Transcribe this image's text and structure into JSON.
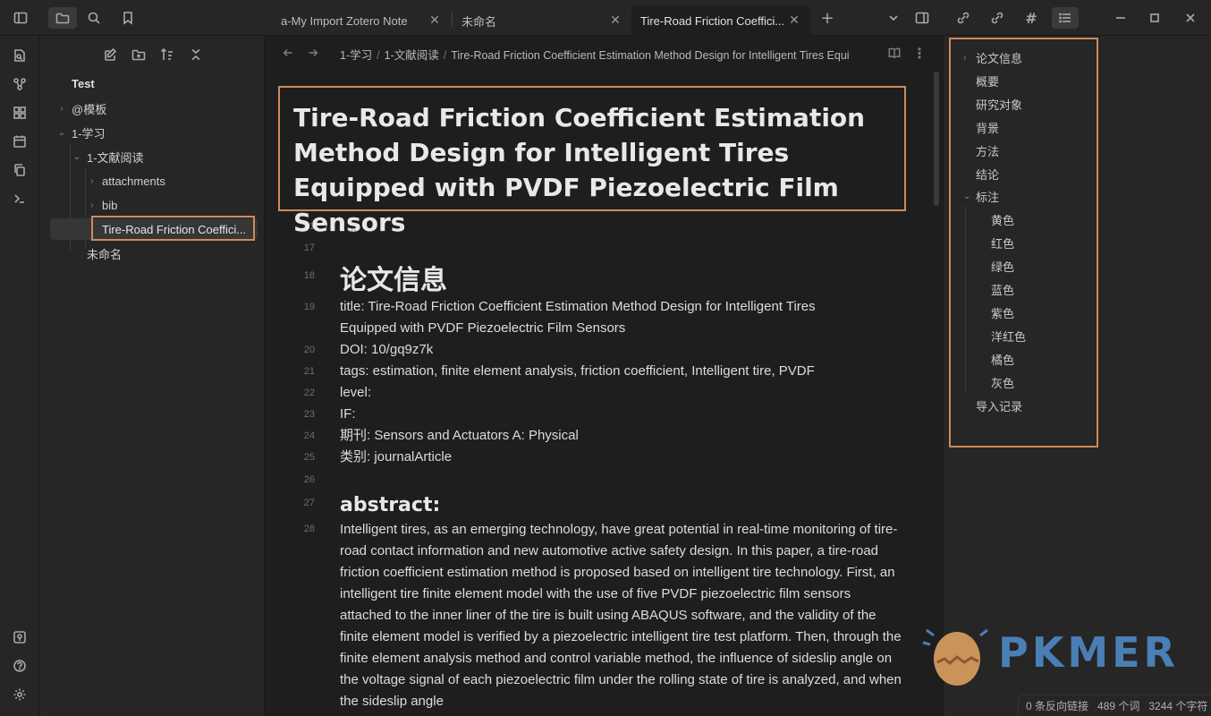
{
  "tabs": [
    {
      "label": "a-My Import Zotero Note",
      "active": false
    },
    {
      "label": "未命名",
      "active": false
    },
    {
      "label": "Tire-Road Friction Coeffici...",
      "active": true
    }
  ],
  "explorer": {
    "vault": "Test",
    "items": [
      {
        "label": "@模板",
        "expanded": false
      },
      {
        "label": "1-学习",
        "expanded": true
      },
      {
        "label": "1-文献阅读",
        "expanded": true
      },
      {
        "label": "attachments",
        "expanded": false
      },
      {
        "label": "bib",
        "expanded": false
      },
      {
        "label": "Tire-Road Friction Coeffici...",
        "selected": true
      },
      {
        "label": "未命名"
      }
    ]
  },
  "breadcrumb": [
    "1-学习",
    "1-文献阅读",
    "Tire-Road Friction Coefficient Estimation Method Design for Intelligent Tires Equi"
  ],
  "editor": {
    "title": "Tire-Road Friction Coefficient Estimation Method Design for Intelligent Tires Equipped with PVDF Piezoelectric Film Sensors",
    "folded_line": "1",
    "folded_text": "...",
    "lines": [
      {
        "n": "17",
        "text": ""
      },
      {
        "n": "18",
        "text": "论文信息"
      },
      {
        "n": "19",
        "text": "title: Tire-Road Friction Coefficient Estimation Method Design for Intelligent Tires"
      },
      {
        "n": "",
        "text": "Equipped with PVDF Piezoelectric Film Sensors"
      },
      {
        "n": "20",
        "text": "DOI: 10/gq9z7k"
      },
      {
        "n": "21",
        "text": "tags: estimation, finite element analysis, friction coefficient, Intelligent tire, PVDF"
      },
      {
        "n": "22",
        "text": "level:"
      },
      {
        "n": "23",
        "text": "IF:"
      },
      {
        "n": "24",
        "text": "期刊: Sensors and Actuators A: Physical"
      },
      {
        "n": "25",
        "text": "类别: journalArticle"
      },
      {
        "n": "26",
        "text": ""
      },
      {
        "n": "27",
        "text": "abstract:"
      },
      {
        "n": "28",
        "text": ""
      }
    ],
    "abstract": "Intelligent tires, as an emerging technology, have great potential in real-time monitoring of tire-road contact information and new automotive active safety design. In this paper, a tire-road friction coefficient estimation method is proposed based on intelligent tire technology. First, an intelligent tire finite element model with the use of five PVDF piezoelectric film sensors attached to the inner liner of the tire is built using ABAQUS software, and the validity of the finite element model is verified by a piezoelectric intelligent tire test platform. Then, through the finite element analysis method and control variable method, the influence of sideslip angle on the voltage signal of each piezoelectric film under the rolling state of tire is analyzed, and when the sideslip angle"
  },
  "outline": {
    "items": [
      {
        "label": "论文信息",
        "level": 1,
        "chevron": "right"
      },
      {
        "label": "概要",
        "level": 1
      },
      {
        "label": "研究对象",
        "level": 1
      },
      {
        "label": "背景",
        "level": 1
      },
      {
        "label": "方法",
        "level": 1
      },
      {
        "label": "结论",
        "level": 1
      },
      {
        "label": "标注",
        "level": 1,
        "chevron": "down"
      },
      {
        "label": "黄色",
        "level": 2
      },
      {
        "label": "红色",
        "level": 2
      },
      {
        "label": "绿色",
        "level": 2
      },
      {
        "label": "蓝色",
        "level": 2
      },
      {
        "label": "紫色",
        "level": 2
      },
      {
        "label": "洋红色",
        "level": 2
      },
      {
        "label": "橘色",
        "level": 2
      },
      {
        "label": "灰色",
        "level": 2
      },
      {
        "label": "导入记录",
        "level": 1
      }
    ]
  },
  "status": {
    "backlinks": "0 条反向链接",
    "words": "489 个词",
    "chars": "3244 个字符"
  },
  "watermark": "PKMER",
  "colors": {
    "highlight_box": "#d08a5a",
    "accent": "#8b6fd8",
    "watermark": "#4a7fb5"
  }
}
